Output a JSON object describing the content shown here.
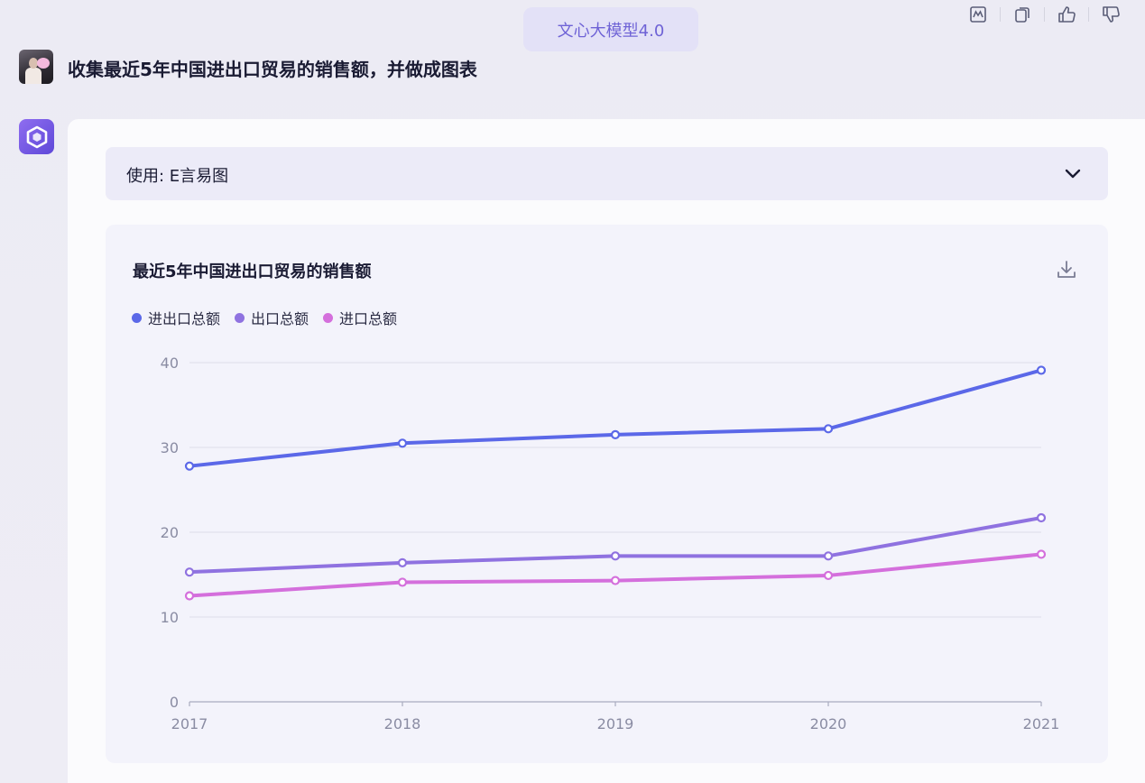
{
  "header": {
    "model_badge": "文心大模型4.0",
    "icons": [
      "chart-icon",
      "copy-icon",
      "thumbs-up-icon",
      "thumbs-down-icon"
    ]
  },
  "conversation": {
    "user_message": "收集最近5年中国进出口贸易的销售额，并做成图表",
    "plugin_label": "使用: E言易图"
  },
  "chart_data": {
    "type": "line",
    "title": "最近5年中国进出口贸易的销售额",
    "categories": [
      "2017",
      "2018",
      "2019",
      "2020",
      "2021"
    ],
    "ylim": [
      0,
      40
    ],
    "yticks": [
      0,
      10,
      20,
      30,
      40
    ],
    "grid": true,
    "legend_position": "top-left",
    "series": [
      {
        "name": "进出口总额",
        "color": "#5b68e8",
        "values": [
          27.8,
          30.5,
          31.5,
          32.2,
          39.1
        ]
      },
      {
        "name": "出口总额",
        "color": "#8f72e0",
        "values": [
          15.3,
          16.4,
          17.2,
          17.2,
          21.7
        ]
      },
      {
        "name": "进口总额",
        "color": "#d46fdc",
        "values": [
          12.5,
          14.1,
          14.3,
          14.9,
          17.4
        ]
      }
    ]
  }
}
